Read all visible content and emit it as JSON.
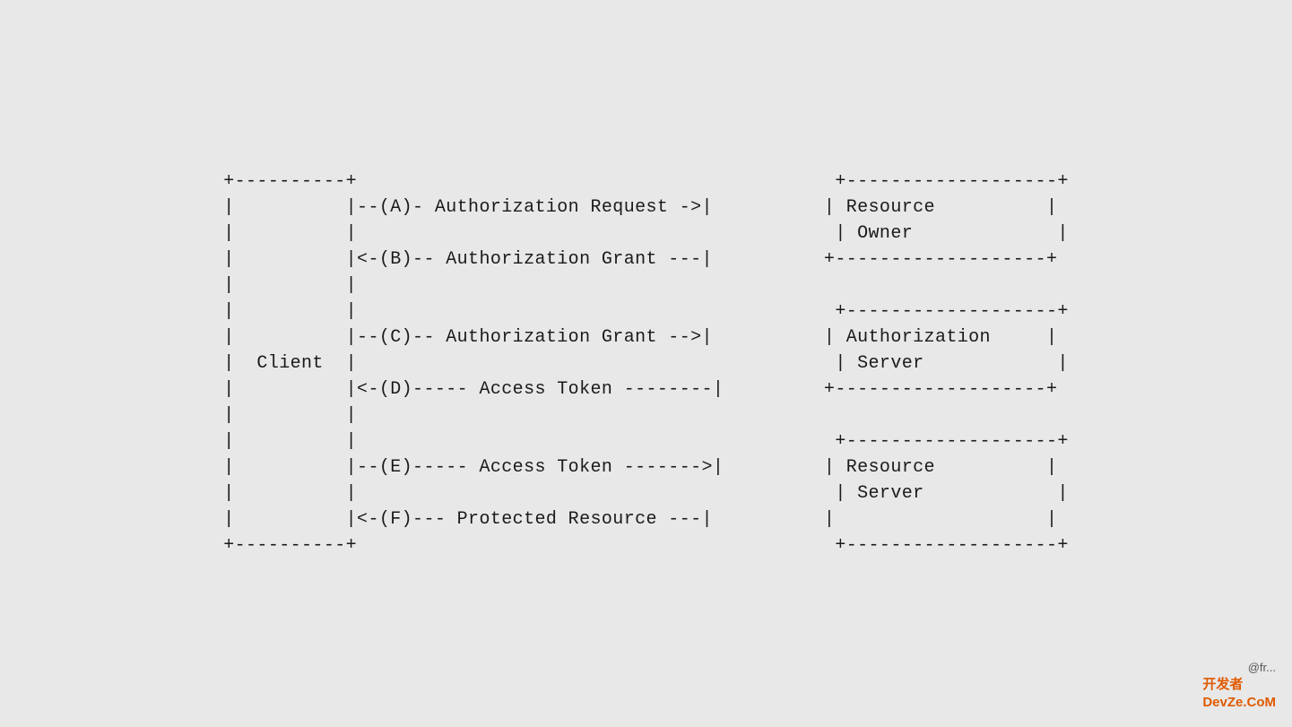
{
  "diagram": {
    "lines": [
      "+----------+                                           +-------------------+",
      "|          |---(A)- Authorization Request ->|          | Resource          |",
      "|          |                                           | Owner             |",
      "|          |<--(B)-- Authorization Grant ---|          +-------------------+",
      "|          |                                                               |",
      "|          |                                           +-------------------+",
      "|          |---(C)-- Authorization Grant -->| Authorization               |",
      "|  Client  |                                           | Server            |",
      "|          |<--(D)----- Access Token --------|          +-------------------+",
      "|          |                                                               |",
      "|          |                                           +-------------------+",
      "|          |---(E)----- Access Token ------->| Resource                   |",
      "|          |                                           | Server            |",
      "|          |<--(F)--- Protected Resource ---|          |                   |",
      "+----------+                                           +-------------------+"
    ],
    "ascii_art": "+----------+                                           +-------------------+\n|          |--(A)- Authorization Request ->|            Resource            |\n|          |                                           |  Owner             |\n|          |<-(B)-- Authorization Grant ---|           +-------------------+\n|          |                                                                \n|          |                                           +-------------------+\n|          |--(C)-- Authorization Grant -->|           Authorization       |\n|  Client  |                               |           Server              |\n|          |<-(D)----- Access Token -------|           +-------------------+\n|          |                                                                \n|          |                                           +-------------------+\n|          |--(E)----- Access Token ------->|          Resource            |\n|          |                               |           Server              |\n|          |<-(F)--- Protected Resource ---|           |                   |\n+----------+                                           +-------------------+"
  },
  "watermark": {
    "line1": "@fr...",
    "line2": "开发者\nDevZe.CoM"
  }
}
